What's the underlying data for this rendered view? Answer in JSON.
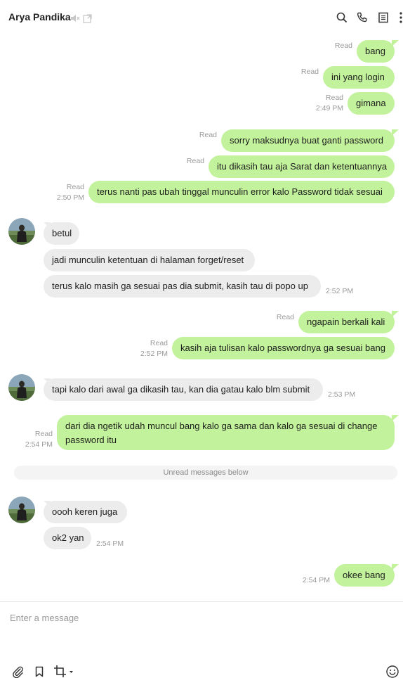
{
  "header": {
    "title": "Arya Pandika",
    "icons": [
      "mute-icon",
      "popout-icon",
      "search-icon",
      "phone-icon",
      "notes-icon",
      "more-icon"
    ]
  },
  "messages": [
    {
      "dir": "out",
      "text": "bang",
      "status": "Read",
      "time": ""
    },
    {
      "dir": "out",
      "text": "ini yang login",
      "status": "Read",
      "time": ""
    },
    {
      "dir": "out",
      "text": "gimana",
      "status": "Read",
      "time": "2:49 PM"
    },
    {
      "dir": "out",
      "text": "sorry maksudnya buat ganti password",
      "status": "Read",
      "time": ""
    },
    {
      "dir": "out",
      "text": "itu dikasih tau aja Sarat dan ketentuannya",
      "status": "Read",
      "time": ""
    },
    {
      "dir": "out",
      "text": "terus nanti pas ubah tinggal munculin error kalo Password tidak sesuai",
      "status": "Read",
      "time": "2:50 PM"
    },
    {
      "dir": "in",
      "text": "betul",
      "time": ""
    },
    {
      "dir": "in",
      "text": "jadi munculin ketentuan di halaman forget/reset",
      "time": ""
    },
    {
      "dir": "in",
      "text": "terus kalo masih ga sesuai pas dia submit, kasih tau di popo up",
      "time": "2:52 PM"
    },
    {
      "dir": "out",
      "text": "ngapain berkali kali",
      "status": "Read",
      "time": ""
    },
    {
      "dir": "out",
      "text": "kasih aja tulisan kalo passwordnya ga sesuai bang",
      "status": "Read",
      "time": "2:52 PM"
    },
    {
      "dir": "in",
      "text": "tapi kalo dari awal ga dikasih tau, kan dia gatau kalo blm submit",
      "time": "2:53 PM"
    },
    {
      "dir": "out",
      "text": "dari dia ngetik udah muncul bang kalo ga sama dan kalo ga sesuai di change password itu",
      "status": "Read",
      "time": "2:54 PM"
    },
    {
      "dir": "in",
      "text": "oooh keren juga",
      "time": ""
    },
    {
      "dir": "in",
      "text": "ok2 yan",
      "time": "2:54 PM"
    },
    {
      "dir": "out",
      "text": "okee bang",
      "status": "",
      "time": "2:54 PM"
    }
  ],
  "divider": "Unread messages below",
  "composer": {
    "placeholder": "Enter a message",
    "tools": [
      "attach-icon",
      "bookmark-icon",
      "crop-icon",
      "emoji-icon"
    ]
  },
  "colors": {
    "outgoing_bubble": "#c2f29b",
    "incoming_bubble": "#ececec",
    "meta_text": "#9a9a9a"
  }
}
